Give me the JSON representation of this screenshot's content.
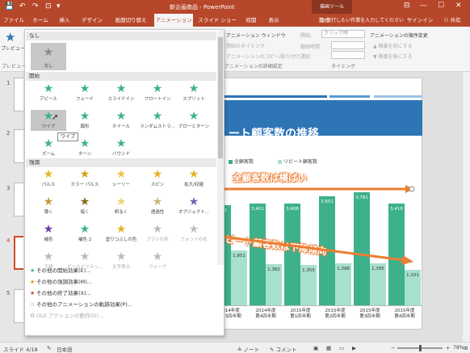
{
  "titlebar": {
    "title": "新企画商品 - PowerPoint",
    "context_group": "描画ツール",
    "qa_save": "💾",
    "qa_undo": "↶",
    "qa_redo": "↷",
    "qa_start": "⊡",
    "qa_more": "▾"
  },
  "tabs": [
    "ファイル",
    "ホーム",
    "挿入",
    "デザイン",
    "画面切り替え",
    "アニメーション",
    "スライド ショー",
    "校閲",
    "表示",
    "書式"
  ],
  "tell_me": "♀ 実行したい作業を入力してください",
  "signin": "サインイン",
  "share": "⚇ 共有",
  "ribbon": {
    "preview_label": "プレビュー",
    "preview_group": "プレビュー",
    "anim_window": "アニメーション ウィンドウ",
    "trigger": "開始のタイミング",
    "painter": "アニメーションのコピー/貼り付け",
    "adv_group": "アニメーションの詳細設定",
    "start_label": "開始:",
    "start_value": "クリック時",
    "duration_label": "継続時間:",
    "delay_label": "遅延:",
    "timing_group": "タイミング",
    "order_title": "アニメーションの順序変更",
    "move_earlier": "▲ 順番を前にする",
    "move_later": "▼ 順番を後にする"
  },
  "gallery": {
    "sections": {
      "none": "なし",
      "entrance": "開始",
      "emphasis": "強調"
    },
    "none_item": "なし",
    "entrance": [
      "アピール",
      "フェード",
      "スライドイン",
      "フロートイン",
      "スプリット",
      "ワイプ",
      "図形",
      "ホイール",
      "ランダムストラ...",
      "グローとターン",
      "ズーム",
      "ターン",
      "バウンド"
    ],
    "emphasis": [
      "パルス",
      "カラー パルス",
      "シーソー",
      "スピン",
      "拡大/収縮",
      "薄く",
      "暗く",
      "明るく",
      "透過性",
      "オブジェクト...",
      "補色",
      "補色 2",
      "塗りつぶしの色",
      "ブラシの色",
      "フォントの色",
      "下線",
      "ボールドフラッ...",
      "太字表示",
      "ウェーブ"
    ],
    "more": [
      "その他の開始効果(E)...",
      "その他の強調効果(M)...",
      "その他の終了効果(X)...",
      "その他のアニメーションの軌跡効果(P)...",
      "OLE アクションの動作(O)..."
    ],
    "tooltip": "ワイプ"
  },
  "colors": {
    "accent": "#b7472a",
    "bar1": "#3cb18c",
    "bar2": "#a8e0cf",
    "title_bar": "#2e75b6",
    "annotation": "#ed7d31"
  },
  "slide": {
    "title": "ート顧客数の推移",
    "annotation1": "全顧客数は横ばい",
    "annotation2": "ピート顧客数は下降傾向"
  },
  "chart_data": {
    "type": "bar",
    "categories": [
      "2014年度\n第3四半期",
      "2014年度\n第4四半期",
      "2015年度\n第1四半期",
      "2015年度\n第2四半期",
      "2015年度\n第3四半期",
      "2015年度\n第4四半期"
    ],
    "series": [
      {
        "name": "全顧客数",
        "values": [
          3341,
          3401,
          3408,
          3651,
          3781,
          3416
        ],
        "labels": [
          "341",
          "3,401",
          "3,408",
          "3,651",
          "3,781",
          "3,416"
        ]
      },
      {
        "name": "リピート顧客数",
        "values": [
          1851,
          1382,
          1355,
          1398,
          1395,
          1201
        ],
        "labels": [
          "1,851",
          "1,382",
          "1,355",
          "1,398",
          "1,395",
          "1,201"
        ]
      }
    ],
    "xlabels": [
      "014年度\n第3四半期",
      "2014年度\n第4四半期",
      "2015年度\n第1四半期",
      "2015年度\n第2四半期",
      "2015年度\n第3四半期",
      "2015年度\n第4四半期"
    ],
    "ylim": [
      0,
      4000
    ]
  },
  "slides_panel": [
    "1",
    "2",
    "3",
    "4",
    "5"
  ],
  "status": {
    "slide": "スライド 4/18",
    "lang": "日本語",
    "notes": "≜ ノート",
    "comments": "✎ コメント",
    "zoom_minus": "−",
    "zoom_plus": "+",
    "zoom": "78%",
    "fit": "⊞"
  },
  "window": {
    "min": "—",
    "max": "☐",
    "close": "✕",
    "ribbon_opts": "⊟"
  }
}
